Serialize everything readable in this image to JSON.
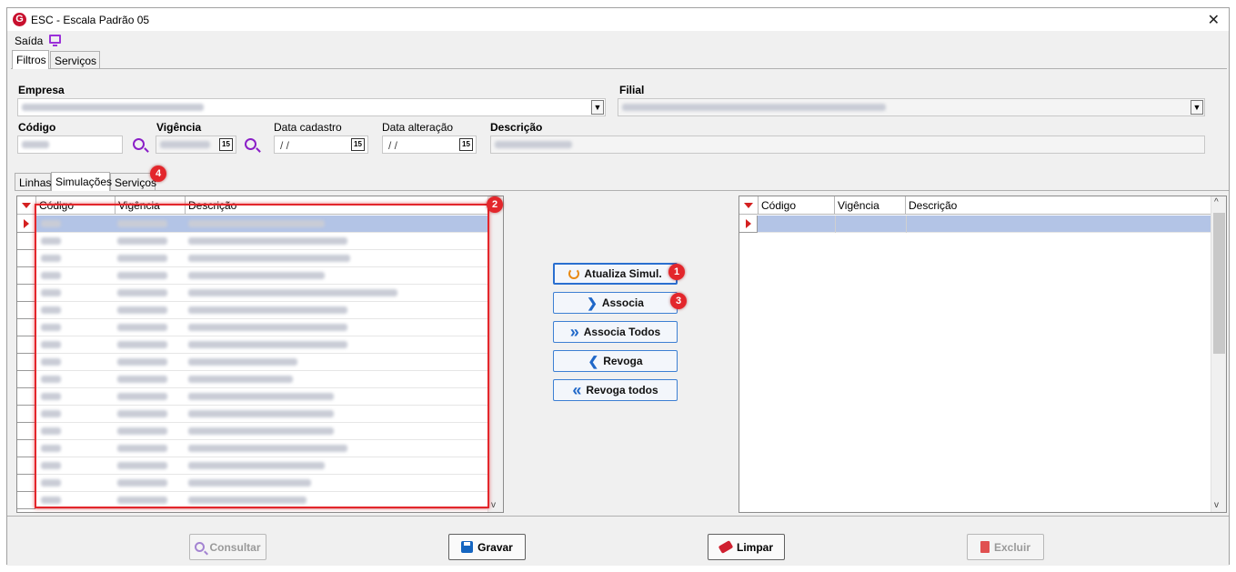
{
  "window": {
    "title": "ESC - Escala Padrão 05",
    "close": "✕"
  },
  "menu": {
    "saida": "Saída"
  },
  "top_tabs": [
    "Filtros",
    "Serviços"
  ],
  "filters": {
    "empresa_label": "Empresa",
    "filial_label": "Filial",
    "codigo_label": "Código",
    "vigencia_label": "Vigência",
    "data_cadastro_label": "Data cadastro",
    "data_cadastro_value": "/ /",
    "data_alteracao_label": "Data alteração",
    "data_alteracao_value": "/ /",
    "descricao_label": "Descrição",
    "calendar_day": "15"
  },
  "mid_tabs": [
    "Linhas",
    "Simulações",
    "Serviços"
  ],
  "left_grid": {
    "columns": [
      "Código",
      "Vigência",
      "Descrição"
    ]
  },
  "right_grid": {
    "columns": [
      "Código",
      "Vigência",
      "Descrição"
    ]
  },
  "actions": {
    "atualiza": "Atualiza Simul.",
    "associa": "Associa",
    "associa_todos": "Associa Todos",
    "revoga": "Revoga",
    "revoga_todos": "Revoga todos"
  },
  "bottom": {
    "consultar": "Consultar",
    "gravar": "Gravar",
    "limpar": "Limpar",
    "excluir": "Excluir"
  },
  "badges": {
    "b1": "1",
    "b2": "2",
    "b3": "3",
    "b4": "4"
  },
  "icons": {
    "dropdown": "▼",
    "arrow_right": "❯",
    "arrow_double_right": "»",
    "arrow_left": "❮",
    "arrow_double_left": "«",
    "scroll_up": "^",
    "scroll_down": "v"
  },
  "colors": {
    "accent": "#1f67c8",
    "annotation": "#e3262b",
    "selection": "#b3c4e6",
    "brand": "#c8102e"
  }
}
